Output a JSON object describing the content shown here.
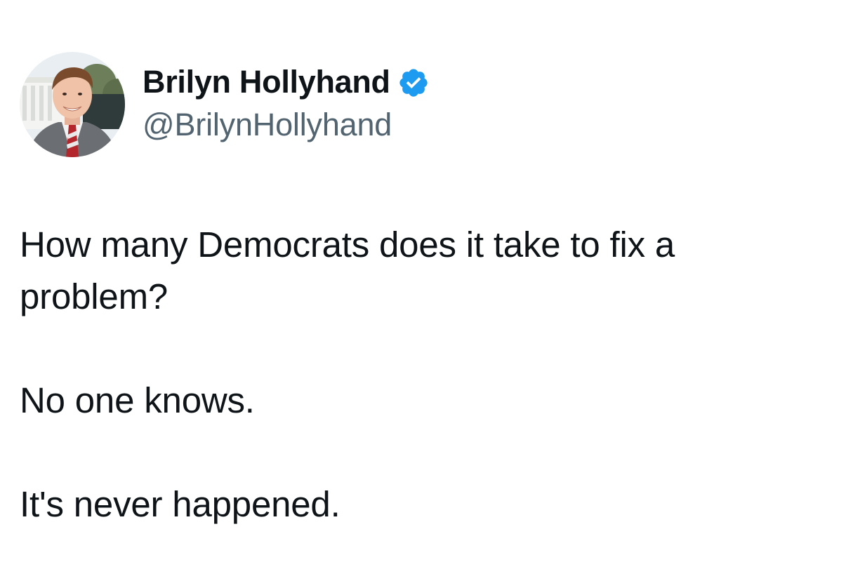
{
  "tweet": {
    "author": {
      "display_name": "Brilyn Hollyhand",
      "handle": "@BrilynHollyhand",
      "verified": true,
      "verified_color": "#1d9bf0",
      "avatar_icon": "profile-photo"
    },
    "text": {
      "line1": "How many Democrats does it take to fix a problem?",
      "line2": "No one knows.",
      "line3": "It's never happened."
    }
  },
  "colors": {
    "text_primary": "#0f1419",
    "text_secondary": "#536471",
    "background": "#ffffff"
  }
}
